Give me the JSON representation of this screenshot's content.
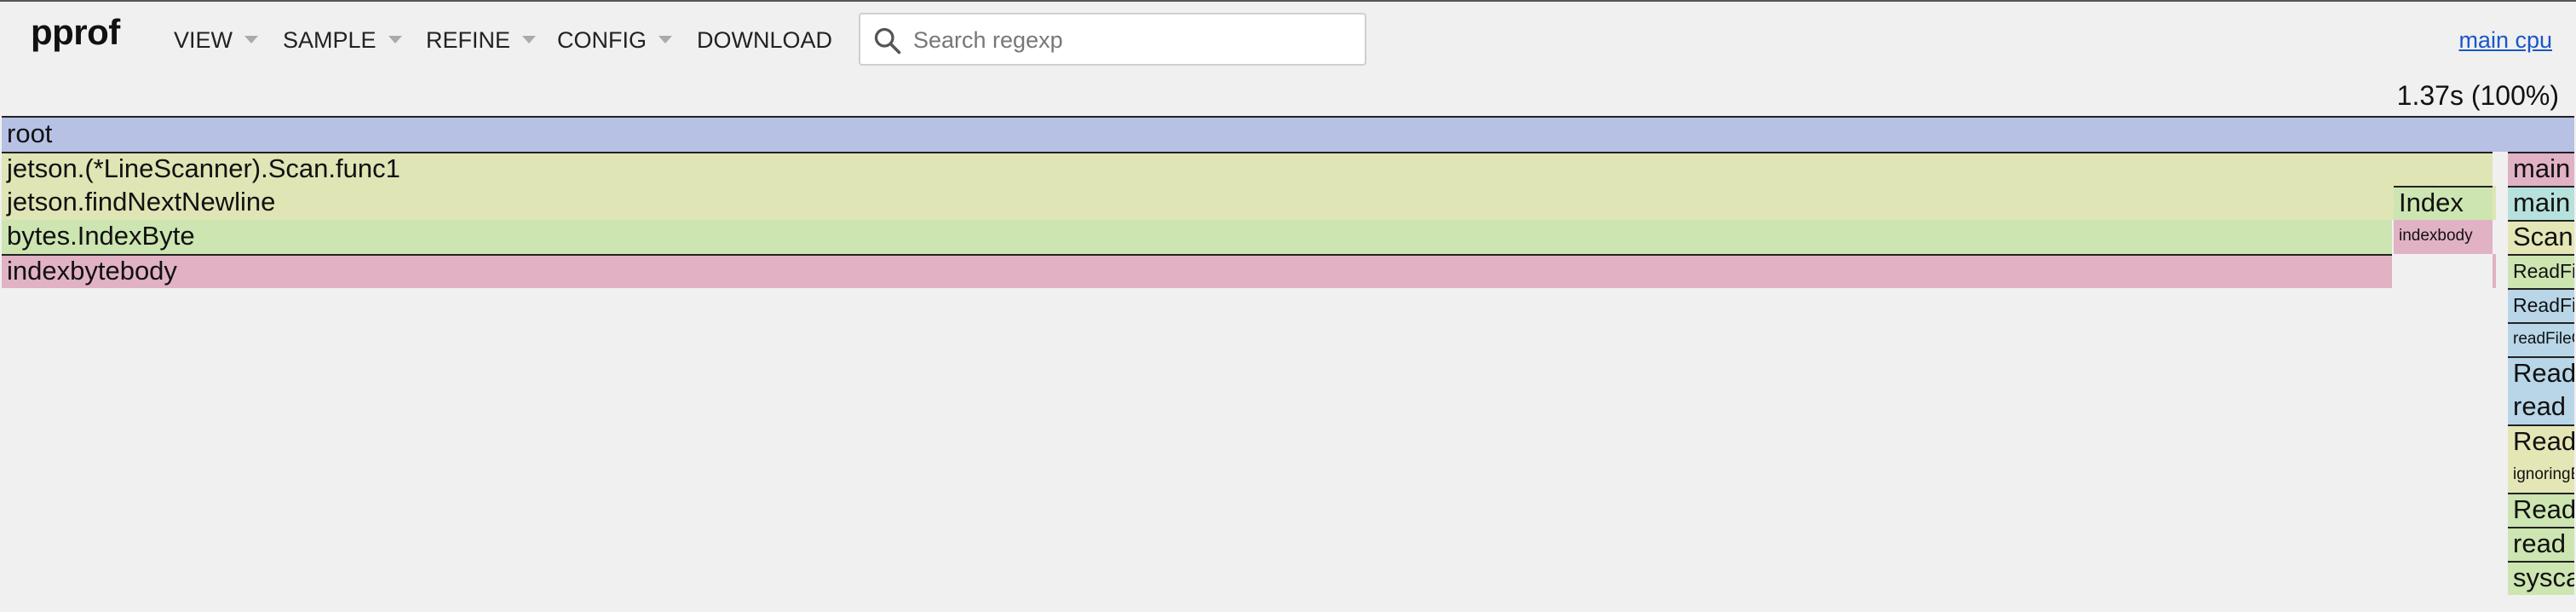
{
  "app": {
    "title": "pprof",
    "profile_link": "main cpu",
    "total": "1.37s (100%)"
  },
  "menu": {
    "items": [
      {
        "label": "VIEW",
        "has_caret": true
      },
      {
        "label": "SAMPLE",
        "has_caret": true
      },
      {
        "label": "REFINE",
        "has_caret": true
      },
      {
        "label": "CONFIG",
        "has_caret": true
      },
      {
        "label": "DOWNLOAD",
        "has_caret": false
      }
    ]
  },
  "search": {
    "placeholder": "Search regexp",
    "value": "",
    "icon": "search-icon"
  },
  "colors": {
    "root": "#b7c1e4",
    "green_light": "#dfe5b4",
    "green": "#cde5b1",
    "pink": "#e1b2c4",
    "blue": "#b8d6e8",
    "teal": "#b6e1dc",
    "yellow": "#e4e6b6"
  },
  "flame": {
    "frames": [
      {
        "label": "root"
      },
      {
        "label": "jetson.(*LineScanner).Scan.func1"
      },
      {
        "label": "jetson.findNextNewline"
      },
      {
        "label": "bytes.IndexByte"
      },
      {
        "label": "indexbytebody"
      },
      {
        "label": "Index"
      },
      {
        "label": "indexbody"
      },
      {
        "label": "main"
      },
      {
        "label": "main"
      },
      {
        "label": "Scan"
      },
      {
        "label": "ReadFile"
      },
      {
        "label": "ReadFile"
      },
      {
        "label": "readFileCo"
      },
      {
        "label": "Read"
      },
      {
        "label": "read"
      },
      {
        "label": "Read"
      },
      {
        "label": "ignoringEIN"
      },
      {
        "label": "Read"
      },
      {
        "label": "read"
      },
      {
        "label": "syscall"
      }
    ]
  }
}
